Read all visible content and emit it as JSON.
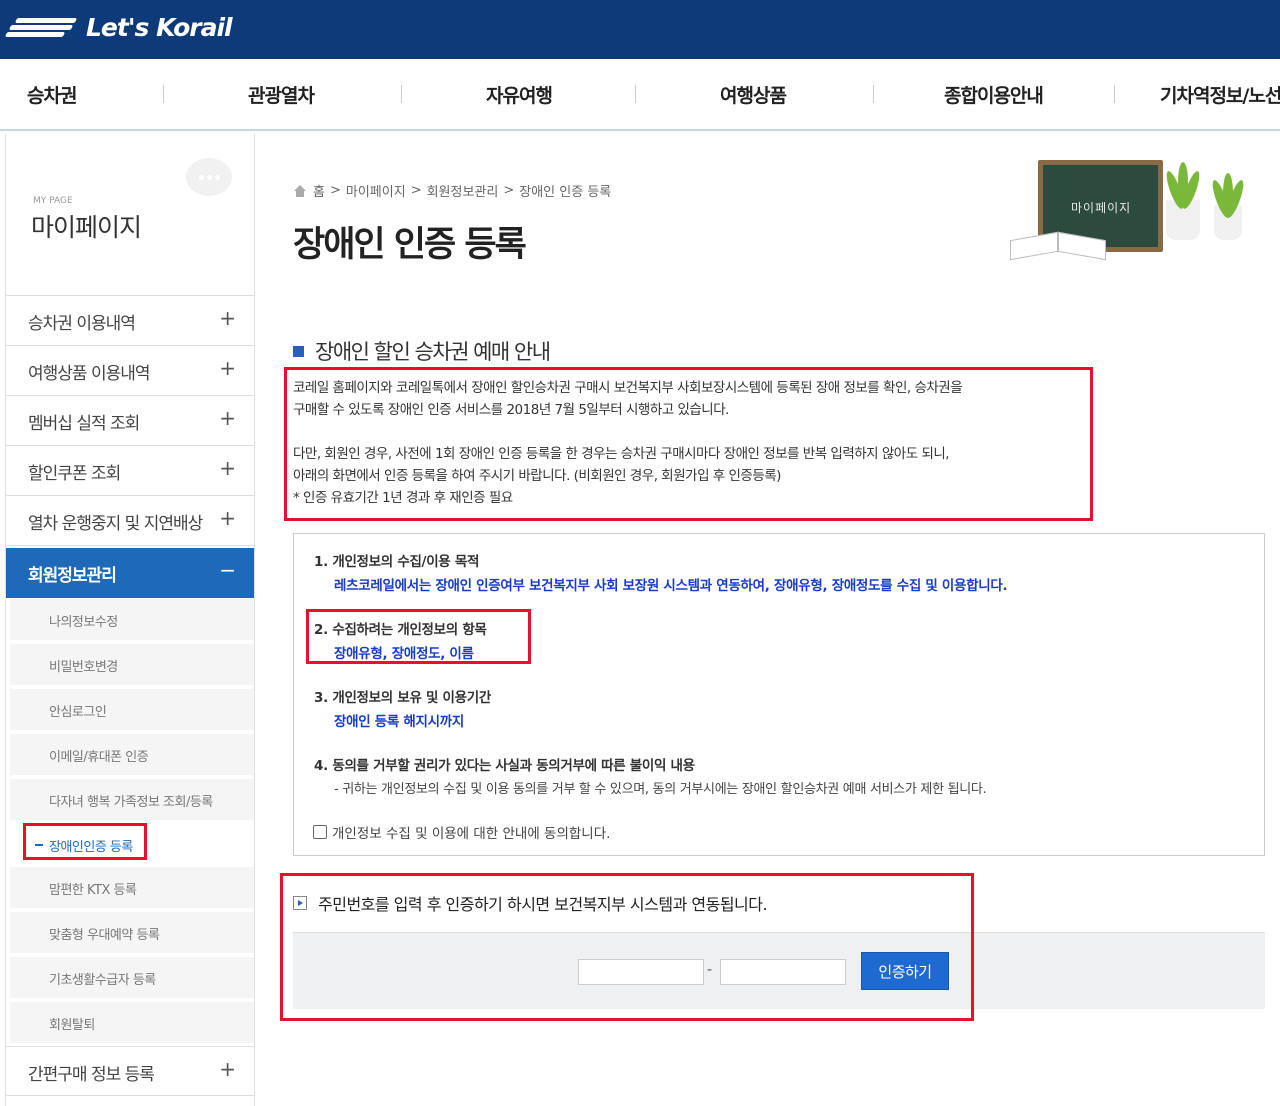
{
  "header": {
    "logo_text": "Let's Korail",
    "brand_color": "#0e3a7a"
  },
  "gnb": {
    "items": [
      "승차권",
      "관광열차",
      "자유여행",
      "여행상품",
      "종합이용안내",
      "기차역정보/노선"
    ]
  },
  "sidebar": {
    "sub_title": "MY PAGE",
    "title": "마이페이지",
    "menus": [
      {
        "label": "승차권 이용내역",
        "sign": "+"
      },
      {
        "label": "여행상품 이용내역",
        "sign": "+"
      },
      {
        "label": "멤버십 실적 조회",
        "sign": "+"
      },
      {
        "label": "할인쿠폰 조회",
        "sign": "+"
      },
      {
        "label": "열차 운행중지 및 지연배상",
        "sign": "+"
      },
      {
        "label": "회원정보관리",
        "sign": "−"
      }
    ],
    "submenus": [
      "나의정보수정",
      "비밀번호변경",
      "안심로그인",
      "이메일/휴대폰 인증",
      "다자녀 행복 가족정보 조회/등록",
      "장애인인증 등록",
      "맘편한 KTX 등록",
      "맞춤형 우대예약 등록",
      "기초생활수급자 등록",
      "회원탈퇴"
    ],
    "last_menu": {
      "label": "간편구매 정보 등록",
      "sign": "+"
    }
  },
  "breadcrumb": {
    "items": [
      "홈",
      "마이페이지",
      "회원정보관리",
      "장애인 인증 등록"
    ]
  },
  "page_title": "장애인 인증 등록",
  "illustration": {
    "board_text": "마이페이지"
  },
  "section": {
    "title": "장애인 할인 승차권 예매 안내",
    "notice_lines": [
      "코레일 홈페이지와 코레일톡에서 장애인 할인승차권 구매시 보건복지부 사회보장시스템에 등록된 장애 정보를 확인, 승차권을",
      "구매할 수 있도록 장애인 인증 서비스를 2018년 7월 5일부터 시행하고 있습니다.",
      "다만, 회원인 경우, 사전에 1회 장애인 인증 등록을 한 경우는 승차권 구매시마다 장애인 정보를 반복 입력하지 않아도 되니,",
      "아래의 화면에서 인증 등록을 하여 주시기 바랍니다. (비회원인 경우, 회원가입 후 인증등록)",
      "* 인증 유효기간 1년 경과 후 재인증 필요"
    ]
  },
  "terms": {
    "items": [
      {
        "q": "1. 개인정보의 수집/이용 목적",
        "a": "레츠코레일에서는 장애인 인증여부 보건복지부 사회 보장원 시스템과 연동하여, 장애유형, 장애정도를 수집 및 이용합니다."
      },
      {
        "q": "2. 수집하려는 개인정보의 항목",
        "a": "장애유형, 장애정도, 이름"
      },
      {
        "q": "3. 개인정보의 보유 및 이용기간",
        "a": "장애인 등록 해지시까지"
      },
      {
        "q": "4. 동의를 거부할 권리가 있다는 사실과 동의거부에 따른 불이익 내용",
        "a": "- 귀하는 개인정보의 수집 및 이용 동의를 거부 할 수 있으며, 동의 거부시에는 장애인 할인승차권 예매 서비스가 제한 됩니다."
      }
    ],
    "agree_label": "개인정보 수집 및 이용에 대한 안내에 동의합니다."
  },
  "auth": {
    "heading": "주민번호를 입력 후 인증하기 하시면 보건복지부 시스템과 연동됩니다.",
    "rrn_front": "",
    "rrn_back": "",
    "separator": "-",
    "button_label": "인증하기"
  },
  "colors": {
    "accent": "#1e6ab8",
    "highlight_box": "#e8112d",
    "answer_text": "#1a3cc7"
  }
}
